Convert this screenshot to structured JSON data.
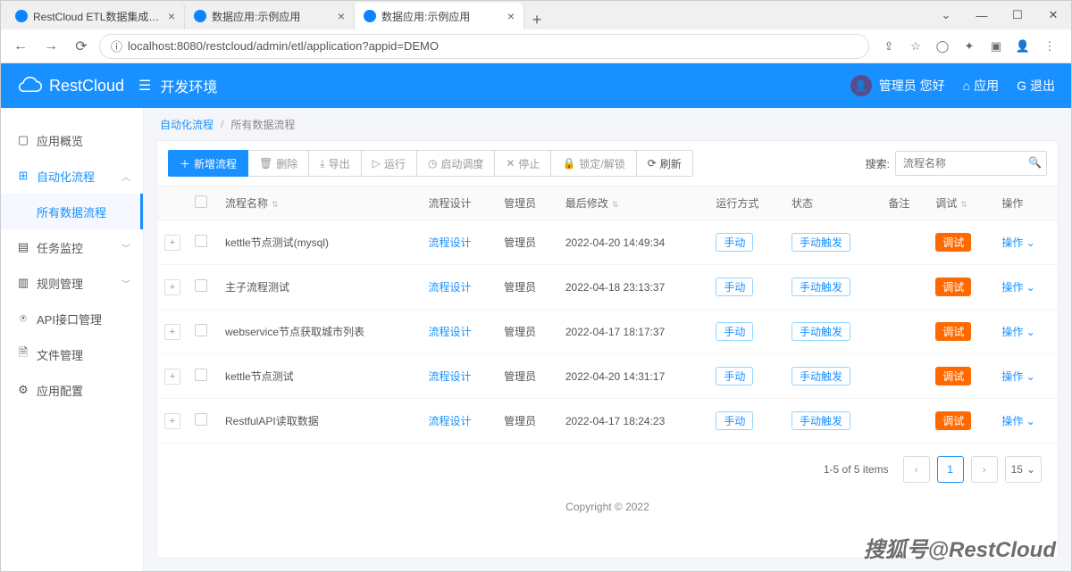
{
  "browser": {
    "tabs": [
      {
        "title": "RestCloud ETL数据集成平台",
        "active": false
      },
      {
        "title": "数据应用:示例应用",
        "active": false
      },
      {
        "title": "数据应用:示例应用",
        "active": true
      }
    ],
    "url": "localhost:8080/restcloud/admin/etl/application?appid=DEMO"
  },
  "header": {
    "brand": "RestCloud",
    "env": "开发环境",
    "greeting": "管理员 您好",
    "app_link": "应用",
    "logout": "退出"
  },
  "sidebar": {
    "items": [
      {
        "label": "应用概览"
      },
      {
        "label": "自动化流程",
        "active": true,
        "expanded": true
      },
      {
        "label": "任务监控",
        "caret": true
      },
      {
        "label": "规则管理",
        "caret": true
      },
      {
        "label": "API接口管理"
      },
      {
        "label": "文件管理"
      },
      {
        "label": "应用配置"
      }
    ],
    "sub_active": "所有数据流程"
  },
  "breadcrumb": {
    "a": "自动化流程",
    "b": "所有数据流程"
  },
  "toolbar": {
    "add": "新增流程",
    "delete": "删除",
    "export": "导出",
    "run": "运行",
    "schedule": "启动调度",
    "stop": "停止",
    "lock": "锁定/解锁",
    "refresh": "刷新",
    "search_label": "搜索:",
    "search_placeholder": "流程名称"
  },
  "columns": {
    "name": "流程名称",
    "design": "流程设计",
    "admin": "管理员",
    "modified": "最后修改",
    "runmode": "运行方式",
    "status": "状态",
    "remark": "备注",
    "debug": "调试",
    "action": "操作"
  },
  "rows": [
    {
      "name": "kettle节点测试(mysql)",
      "design": "流程设计",
      "admin": "管理员",
      "modified": "2022-04-20 14:49:34",
      "runmode": "手动",
      "status": "手动触发",
      "debug": "调试",
      "action": "操作"
    },
    {
      "name": "主子流程测试",
      "design": "流程设计",
      "admin": "管理员",
      "modified": "2022-04-18 23:13:37",
      "runmode": "手动",
      "status": "手动触发",
      "debug": "调试",
      "action": "操作"
    },
    {
      "name": "webservice节点获取城市列表",
      "design": "流程设计",
      "admin": "管理员",
      "modified": "2022-04-17 18:17:37",
      "runmode": "手动",
      "status": "手动触发",
      "debug": "调试",
      "action": "操作"
    },
    {
      "name": "kettle节点测试",
      "design": "流程设计",
      "admin": "管理员",
      "modified": "2022-04-20 14:31:17",
      "runmode": "手动",
      "status": "手动触发",
      "debug": "调试",
      "action": "操作"
    },
    {
      "name": "RestfulAPI读取数据",
      "design": "流程设计",
      "admin": "管理员",
      "modified": "2022-04-17 18:24:23",
      "runmode": "手动",
      "status": "手动触发",
      "debug": "调试",
      "action": "操作"
    }
  ],
  "pagination": {
    "info": "1-5 of 5 items",
    "current": "1",
    "size": "15"
  },
  "footer": {
    "copyright": "Copyright © 2022"
  },
  "watermark": "搜狐号@RestCloud"
}
